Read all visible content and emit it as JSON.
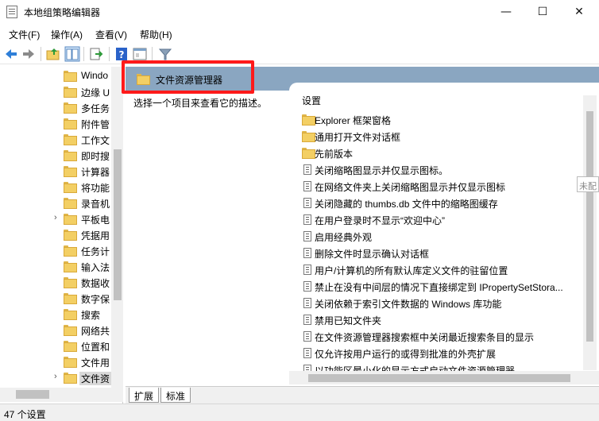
{
  "window": {
    "title": "本地组策略编辑器",
    "minimize": "—",
    "maximize": "☐",
    "close": "✕"
  },
  "menu": [
    "文件(F)",
    "操作(A)",
    "查看(V)",
    "帮助(H)"
  ],
  "toolbar_icons": [
    "back-arrow-icon",
    "forward-arrow-icon",
    "folder-up-icon",
    "show-tree-icon",
    "export-icon",
    "help-icon",
    "properties-icon",
    "filter-icon"
  ],
  "tree": {
    "items": [
      {
        "label": "Windo",
        "expandable": false
      },
      {
        "label": "边缘 U",
        "expandable": false
      },
      {
        "label": "多任务",
        "expandable": false
      },
      {
        "label": "附件管",
        "expandable": false
      },
      {
        "label": "工作文",
        "expandable": false
      },
      {
        "label": "即时搜",
        "expandable": false
      },
      {
        "label": "计算器",
        "expandable": false
      },
      {
        "label": "将功能",
        "expandable": false
      },
      {
        "label": "录音机",
        "expandable": false
      },
      {
        "label": "平板电",
        "expandable": true
      },
      {
        "label": "凭据用",
        "expandable": false
      },
      {
        "label": "任务计",
        "expandable": false
      },
      {
        "label": "输入法",
        "expandable": false
      },
      {
        "label": "数据收",
        "expandable": false
      },
      {
        "label": "数字保",
        "expandable": false
      },
      {
        "label": "搜索",
        "expandable": false
      },
      {
        "label": "网络共",
        "expandable": false
      },
      {
        "label": "位置和",
        "expandable": false
      },
      {
        "label": "文件用",
        "expandable": false
      },
      {
        "label": "文件资",
        "expandable": true,
        "selected": true
      }
    ]
  },
  "details": {
    "header_title": "文件资源管理器",
    "description": "选择一个项目来查看它的描述。",
    "column_header": "设置",
    "tooltip": "未配",
    "items": [
      {
        "type": "folder",
        "label": "Explorer 框架窗格"
      },
      {
        "type": "folder",
        "label": "通用打开文件对话框"
      },
      {
        "type": "folder",
        "label": "先前版本"
      },
      {
        "type": "setting",
        "label": "关闭缩略图显示并仅显示图标。"
      },
      {
        "type": "setting",
        "label": "在网络文件夹上关闭缩略图显示并仅显示图标"
      },
      {
        "type": "setting",
        "label": "关闭隐藏的 thumbs.db 文件中的缩略图缓存"
      },
      {
        "type": "setting",
        "label": "在用户登录时不显示“欢迎中心”"
      },
      {
        "type": "setting",
        "label": "启用经典外观"
      },
      {
        "type": "setting",
        "label": "删除文件时显示确认对话框"
      },
      {
        "type": "setting",
        "label": "用户/计算机的所有默认库定义文件的驻留位置"
      },
      {
        "type": "setting",
        "label": "禁止在没有中间层的情况下直接绑定到 IPropertySetStora..."
      },
      {
        "type": "setting",
        "label": "关闭依赖于索引文件数据的 Windows 库功能"
      },
      {
        "type": "setting",
        "label": "禁用已知文件夹"
      },
      {
        "type": "setting",
        "label": "在文件资源管理器搜索框中关闭最近搜索条目的显示"
      },
      {
        "type": "setting",
        "label": "仅允许按用户运行的或得到批准的外壳扩展"
      },
      {
        "type": "setting",
        "label": "以功能区最小化的显示方式启动文件资源管理器"
      }
    ]
  },
  "tabs": [
    "扩展",
    "标准"
  ],
  "status": "47 个设置"
}
